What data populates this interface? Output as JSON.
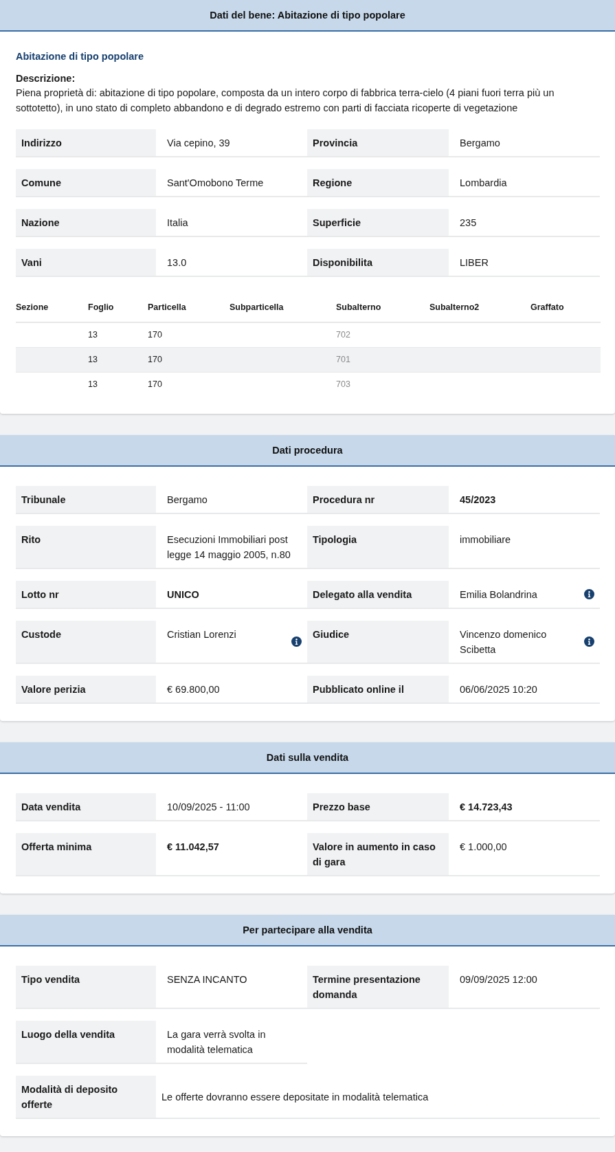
{
  "sections": [
    {
      "title": "Dati del bene: Abitazione di tipo popolare",
      "subtitle": "Abitazione di tipo popolare",
      "description_label": "Descrizione:",
      "description": "Piena proprietà di: abitazione di tipo popolare, composta da un intero corpo di fabbrica terra-cielo (4 piani fuori terra più un sottotetto), in uno stato di completo abbandono e di degrado estremo con parti di facciata ricoperte di vegetazione",
      "rows": [
        {
          "kind": "pairs",
          "fields": [
            {
              "label": "Indirizzo",
              "value": "Via cepino, 39"
            },
            {
              "label": "Provincia",
              "value": "Bergamo"
            }
          ]
        },
        {
          "kind": "pairs",
          "fields": [
            {
              "label": "Comune",
              "value": "Sant'Omobono Terme"
            },
            {
              "label": "Regione",
              "value": "Lombardia"
            }
          ]
        },
        {
          "kind": "pairs",
          "fields": [
            {
              "label": "Nazione",
              "value": "Italia"
            },
            {
              "label": "Superficie",
              "value": "235"
            }
          ]
        },
        {
          "kind": "pairs",
          "fields": [
            {
              "label": "Vani",
              "value": "13.0"
            },
            {
              "label": "Disponibilita",
              "value": "LIBER"
            }
          ]
        }
      ],
      "table": {
        "columns": [
          "Sezione",
          "Foglio",
          "Particella",
          "Subparticella",
          "Subalterno",
          "Subalterno2",
          "Graffato"
        ],
        "rows": [
          [
            "",
            "13",
            "170",
            "",
            "702",
            "",
            ""
          ],
          [
            "",
            "13",
            "170",
            "",
            "701",
            "",
            ""
          ],
          [
            "",
            "13",
            "170",
            "",
            "703",
            "",
            ""
          ]
        ]
      }
    },
    {
      "title": "Dati procedura",
      "rows": [
        {
          "kind": "pairs",
          "fields": [
            {
              "label": "Tribunale",
              "value": "Bergamo"
            },
            {
              "label": "Procedura nr",
              "value": "45/2023",
              "emphasis": true
            }
          ]
        },
        {
          "kind": "pairs",
          "fields": [
            {
              "label": "Rito",
              "value": "Esecuzioni Immobiliari post legge 14 maggio 2005, n.80"
            },
            {
              "label": "Tipologia",
              "value": "immobiliare"
            }
          ]
        },
        {
          "kind": "pairs",
          "fields": [
            {
              "label": "Lotto nr",
              "value": "UNICO",
              "emphasis": true
            },
            {
              "label": "Delegato alla vendita",
              "value": "Emilia Bolandrina",
              "info": true
            }
          ]
        },
        {
          "kind": "pairs",
          "fields": [
            {
              "label": "Custode",
              "value": "Cristian Lorenzi",
              "info": true
            },
            {
              "label": "Giudice",
              "value": "Vincenzo domenico Scibetta",
              "info": true
            }
          ]
        },
        {
          "kind": "pairs",
          "fields": [
            {
              "label": "Valore perizia",
              "value": "€ 69.800,00"
            },
            {
              "label": "Pubblicato online il",
              "value": "06/06/2025 10:20"
            }
          ]
        }
      ]
    },
    {
      "title": "Dati sulla vendita",
      "rows": [
        {
          "kind": "pairs",
          "fields": [
            {
              "label": "Data vendita",
              "value": "10/09/2025 - 11:00"
            },
            {
              "label": "Prezzo base",
              "value": "€ 14.723,43",
              "emphasis": true
            }
          ]
        },
        {
          "kind": "pairs",
          "fields": [
            {
              "label": "Offerta minima",
              "value": "€ 11.042,57",
              "emphasis": true
            },
            {
              "label": "Valore in aumento in caso di gara",
              "value": "€ 1.000,00"
            }
          ]
        }
      ]
    },
    {
      "title": "Per partecipare alla vendita",
      "rows": [
        {
          "kind": "pairs",
          "fields": [
            {
              "label": "Tipo vendita",
              "value": "SENZA INCANTO"
            },
            {
              "label": "Termine presentazione domanda",
              "value": "09/09/2025 12:00"
            }
          ]
        },
        {
          "kind": "pairs",
          "fields": [
            {
              "label": "Luogo della vendita",
              "value": "La gara verrà svolta in modalità telematica"
            }
          ]
        },
        {
          "kind": "wide",
          "fields": [
            {
              "label": "Modalità di deposito offerte",
              "value": "Le offerte dovranno essere depositate in modalità telematica"
            }
          ]
        }
      ]
    }
  ]
}
